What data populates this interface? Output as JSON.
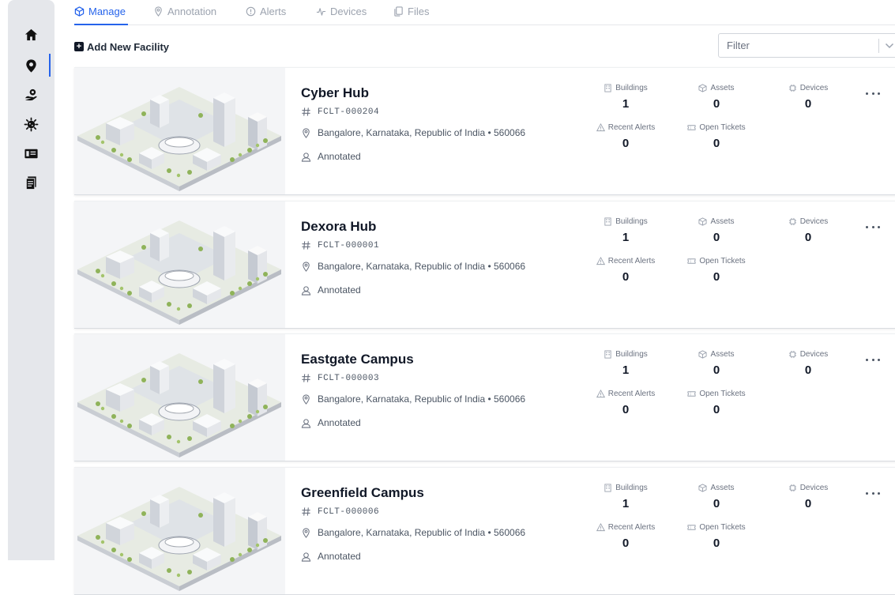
{
  "sidebar": {
    "items": [
      {
        "icon": "home-icon"
      },
      {
        "icon": "location-pin-icon",
        "active": true
      },
      {
        "icon": "hand-gear-icon"
      },
      {
        "icon": "virus-icon"
      },
      {
        "icon": "ticket-icon"
      },
      {
        "icon": "document-icon"
      }
    ]
  },
  "tabs": [
    {
      "label": "Manage",
      "icon": "cube-icon",
      "active": true
    },
    {
      "label": "Annotation",
      "icon": "pin-icon"
    },
    {
      "label": "Alerts",
      "icon": "alert-circle-icon"
    },
    {
      "label": "Devices",
      "icon": "pulse-icon"
    },
    {
      "label": "Files",
      "icon": "files-icon"
    }
  ],
  "toolbar": {
    "add_label": "Add New Facility",
    "filter_placeholder": "Filter"
  },
  "stat_labels": {
    "buildings": "Buildings",
    "assets": "Assets",
    "devices": "Devices",
    "recent_alerts": "Recent Alerts",
    "open_tickets": "Open Tickets"
  },
  "facilities": [
    {
      "name": "Cyber Hub",
      "code": "FCLT-000204",
      "address": "Bangalore, Karnataka, Republic of India • 560066",
      "status": "Annotated",
      "buildings": "1",
      "assets": "0",
      "devices": "0",
      "recent_alerts": "0",
      "open_tickets": "0"
    },
    {
      "name": "Dexora Hub",
      "code": "FCLT-000001",
      "address": "Bangalore, Karnataka, Republic of India • 560066",
      "status": "Annotated",
      "buildings": "1",
      "assets": "0",
      "devices": "0",
      "recent_alerts": "0",
      "open_tickets": "0"
    },
    {
      "name": "Eastgate Campus",
      "code": "FCLT-000003",
      "address": "Bangalore, Karnataka, Republic of India • 560066",
      "status": "Annotated",
      "buildings": "1",
      "assets": "0",
      "devices": "0",
      "recent_alerts": "0",
      "open_tickets": "0"
    },
    {
      "name": "Greenfield Campus",
      "code": "FCLT-000006",
      "address": "Bangalore, Karnataka, Republic of India • 560066",
      "status": "Annotated",
      "buildings": "1",
      "assets": "0",
      "devices": "0",
      "recent_alerts": "0",
      "open_tickets": "0"
    }
  ],
  "colors": {
    "accent": "#2563eb",
    "sidebar_bg": "#e5e7eb",
    "text_dark": "#111827",
    "text_muted": "#6b7280"
  }
}
